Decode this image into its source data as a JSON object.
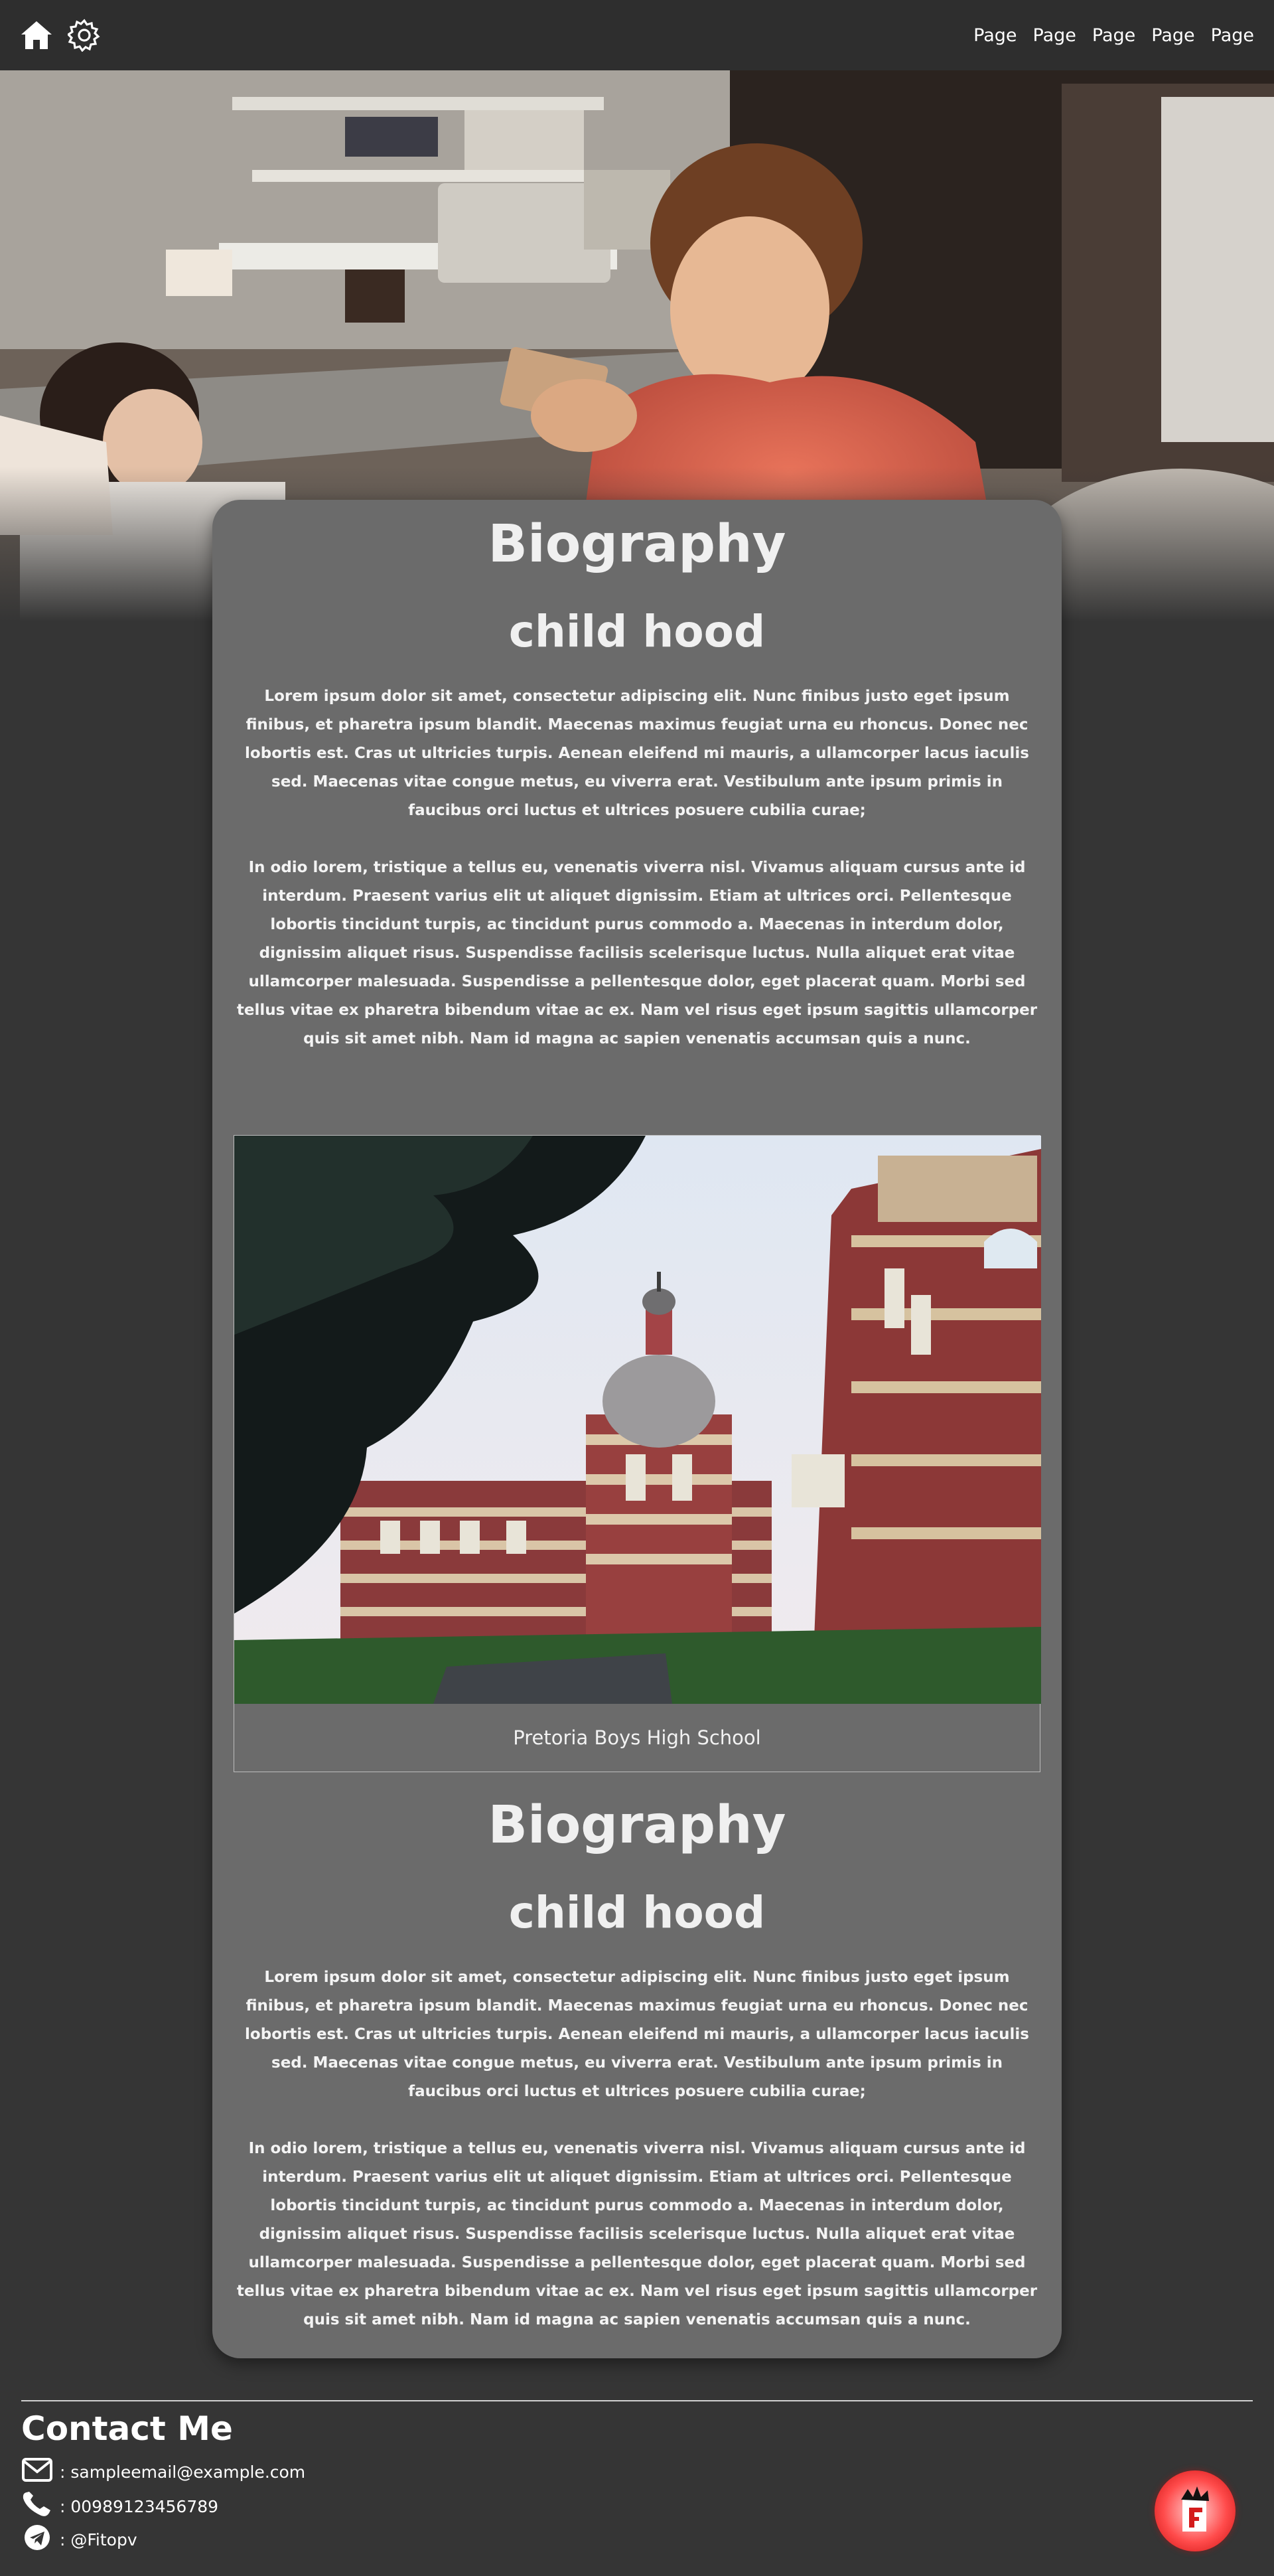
{
  "nav": {
    "links": [
      "Page",
      "Page",
      "Page",
      "Page",
      "Page"
    ],
    "icons": [
      "home-icon",
      "gear-icon"
    ]
  },
  "sections": [
    {
      "title": "Biography",
      "subtitle": "child hood",
      "paragraphs": [
        "Lorem ipsum dolor sit amet, consectetur adipiscing elit. Nunc finibus justo eget ipsum finibus, et pharetra ipsum blandit. Maecenas maximus feugiat urna eu rhoncus. Donec nec lobortis est. Cras ut ultricies turpis. Aenean eleifend mi mauris, a ullamcorper lacus iaculis sed. Maecenas vitae congue metus, eu viverra erat. Vestibulum ante ipsum primis in faucibus orci luctus et ultrices posuere cubilia curae;",
        "In odio lorem, tristique a tellus eu, venenatis viverra nisl. Vivamus aliquam cursus ante id interdum. Praesent varius elit ut aliquet dignissim. Etiam at ultrices orci. Pellentesque lobortis tincidunt turpis, ac tincidunt purus commodo a. Maecenas in interdum dolor, dignissim aliquet risus. Suspendisse facilisis scelerisque luctus. Nulla aliquet erat vitae ullamcorper malesuada. Suspendisse a pellentesque dolor, eget placerat quam. Morbi sed tellus vitae ex pharetra bibendum vitae ac ex. Nam vel risus eget ipsum sagittis ullamcorper quis sit amet nibh. Nam id magna ac sapien venenatis accumsan quis a nunc."
      ]
    },
    {
      "title": "Biography",
      "subtitle": "child hood",
      "paragraphs": [
        "Lorem ipsum dolor sit amet, consectetur adipiscing elit. Nunc finibus justo eget ipsum finibus, et pharetra ipsum blandit. Maecenas maximus feugiat urna eu rhoncus. Donec nec lobortis est. Cras ut ultricies turpis. Aenean eleifend mi mauris, a ullamcorper lacus iaculis sed. Maecenas vitae congue metus, eu viverra erat. Vestibulum ante ipsum primis in faucibus orci luctus et ultrices posuere cubilia curae;",
        "In odio lorem, tristique a tellus eu, venenatis viverra nisl. Vivamus aliquam cursus ante id interdum. Praesent varius elit ut aliquet dignissim. Etiam at ultrices orci. Pellentesque lobortis tincidunt turpis, ac tincidunt purus commodo a. Maecenas in interdum dolor, dignissim aliquet risus. Suspendisse facilisis scelerisque luctus. Nulla aliquet erat vitae ullamcorper malesuada. Suspendisse a pellentesque dolor, eget placerat quam. Morbi sed tellus vitae ex pharetra bibendum vitae ac ex. Nam vel risus eget ipsum sagittis ullamcorper quis sit amet nibh. Nam id magna ac sapien venenatis accumsan quis a nunc."
      ]
    }
  ],
  "figure": {
    "caption": "Pretoria Boys High School"
  },
  "contact": {
    "title": "Contact Me",
    "email": ": sampleemail@example.com",
    "phone": ": 00989123456789",
    "telegram": ": @Fitopv",
    "icons": [
      "email-icon",
      "phone-icon",
      "telegram-icon"
    ]
  },
  "colors": {
    "page_bg": "#353535",
    "nav_bg": "#2e2e2e",
    "card_bg": "#6b6b6b",
    "logo_red": "#e02020"
  }
}
